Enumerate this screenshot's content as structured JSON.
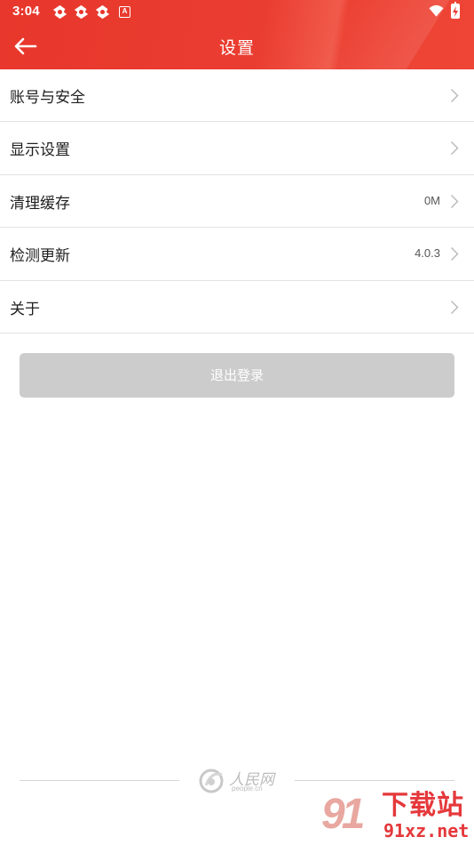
{
  "status_bar": {
    "time": "3:04",
    "notification_icons": [
      "app-notification-icon",
      "app-notification-icon",
      "app-notification-icon"
    ],
    "a_icon_letter": "A",
    "wifi_icon": "wifi-icon",
    "battery_icon": "battery-charging-icon"
  },
  "toolbar": {
    "title": "设置",
    "back_icon": "arrow-left-icon"
  },
  "settings": {
    "items": [
      {
        "label": "账号与安全",
        "value": ""
      },
      {
        "label": "显示设置",
        "value": ""
      },
      {
        "label": "清理缓存",
        "value": "0M"
      },
      {
        "label": "检测更新",
        "value": "4.0.3"
      },
      {
        "label": "关于",
        "value": ""
      }
    ]
  },
  "logout": {
    "label": "退出登录"
  },
  "footer": {
    "logo_text": "人民网",
    "logo_sub": "people.cn"
  },
  "watermark": {
    "number": "91",
    "text": "下载站",
    "url": "91xz.net"
  },
  "colors": {
    "brand_red": "#e8372c",
    "disabled_button": "#cccccc",
    "divider": "#e3e3e3"
  }
}
